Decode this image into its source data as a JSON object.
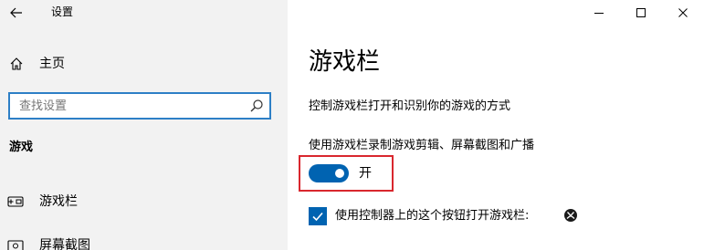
{
  "window": {
    "title": "设置",
    "controls": {
      "minimize_icon": "minimize-icon",
      "maximize_icon": "maximize-icon",
      "close_icon": "close-icon"
    }
  },
  "sidebar": {
    "home_label": "主页",
    "search": {
      "placeholder": "查找设置",
      "value": ""
    },
    "section_title": "游戏",
    "items": [
      {
        "label": "游戏栏",
        "icon": "game-bar-icon"
      },
      {
        "label": "屏幕截图",
        "icon": "capture-icon"
      }
    ]
  },
  "main": {
    "page_title": "游戏栏",
    "description": "控制游戏栏打开和识别你的游戏的方式",
    "toggle_setting": {
      "label": "使用游戏栏录制游戏剪辑、屏幕截图和广播",
      "state_label": "开",
      "on": true
    },
    "checkbox_setting": {
      "label": "使用控制器上的这个按钮打开游戏栏:",
      "checked": true,
      "icon": "xbox-icon"
    }
  },
  "colors": {
    "accent": "#0063b1",
    "search_border": "#2d7fc6",
    "highlight": "#d9272e",
    "sidebar_bg": "#f2f2f2"
  }
}
